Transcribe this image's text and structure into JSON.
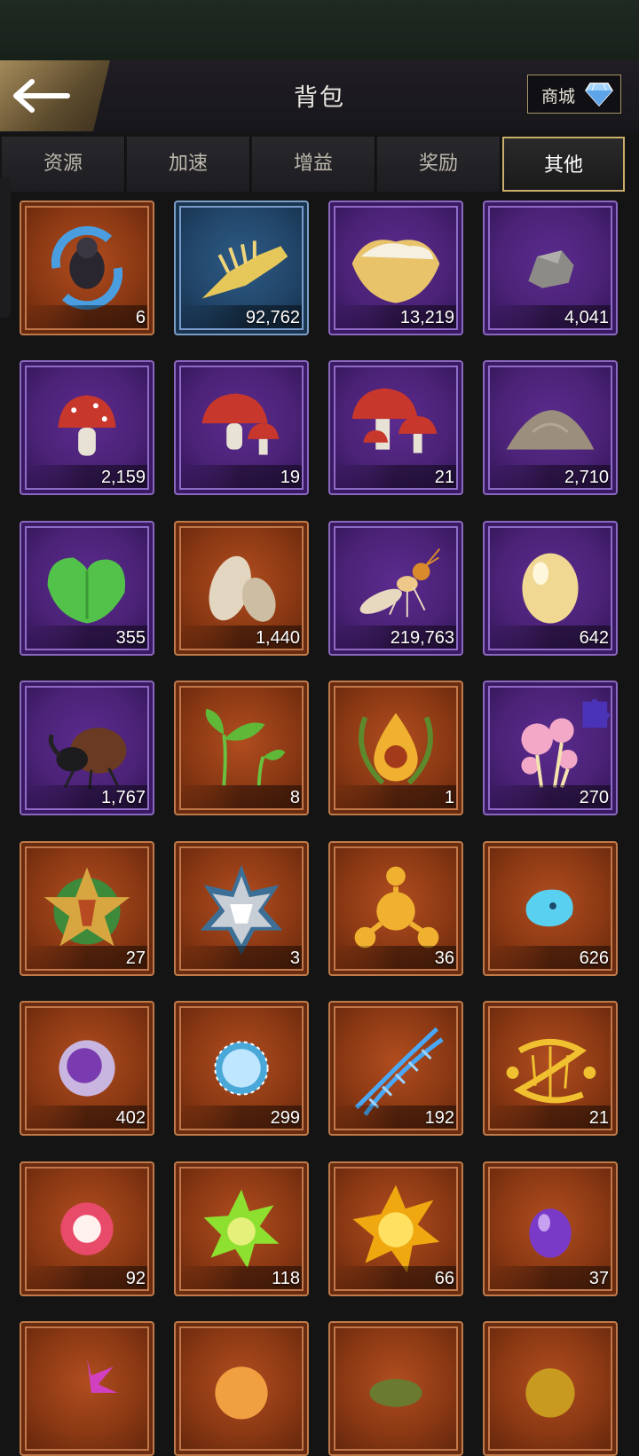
{
  "header": {
    "title": "背包",
    "back_icon": "back-arrow-icon",
    "shop_label": "商城",
    "shop_icon": "diamond-icon"
  },
  "tabs": [
    {
      "label": "资源",
      "active": false
    },
    {
      "label": "加速",
      "active": false
    },
    {
      "label": "增益",
      "active": false
    },
    {
      "label": "奖励",
      "active": false
    },
    {
      "label": "其他",
      "active": true
    }
  ],
  "items": [
    {
      "icon": "ant-swap-icon",
      "rarity": "orange",
      "count": "6"
    },
    {
      "icon": "fish-skeleton-icon",
      "rarity": "blue",
      "count": "92,762"
    },
    {
      "icon": "oyster-mushroom-icon",
      "rarity": "purple",
      "count": "13,219"
    },
    {
      "icon": "stone-icon",
      "rarity": "purple",
      "count": "4,041"
    },
    {
      "icon": "mushroom-icon",
      "rarity": "purple",
      "count": "2,159"
    },
    {
      "icon": "mushroom-pair-icon",
      "rarity": "purple",
      "count": "19"
    },
    {
      "icon": "mushroom-cluster-icon",
      "rarity": "purple",
      "count": "21"
    },
    {
      "icon": "sand-pile-icon",
      "rarity": "purple",
      "count": "2,710"
    },
    {
      "icon": "leaf-icon",
      "rarity": "purple",
      "count": "355"
    },
    {
      "icon": "seeds-icon",
      "rarity": "orange",
      "count": "1,440"
    },
    {
      "icon": "termite-icon",
      "rarity": "purple",
      "count": "219,763"
    },
    {
      "icon": "egg-icon",
      "rarity": "purple",
      "count": "642"
    },
    {
      "icon": "beetle-icon",
      "rarity": "purple",
      "count": "1,767"
    },
    {
      "icon": "sprout-icon",
      "rarity": "orange",
      "count": "8"
    },
    {
      "icon": "laurel-drop-icon",
      "rarity": "orange",
      "count": "1"
    },
    {
      "icon": "pink-mushroom-puzzle-icon",
      "rarity": "purple",
      "count": "270"
    },
    {
      "icon": "gold-star-medal-icon",
      "rarity": "orange",
      "count": "27"
    },
    {
      "icon": "silver-star-medal-icon",
      "rarity": "orange",
      "count": "3"
    },
    {
      "icon": "gold-molecule-icon",
      "rarity": "orange",
      "count": "36"
    },
    {
      "icon": "blue-crystal-icon",
      "rarity": "orange",
      "count": "626"
    },
    {
      "icon": "purple-cell-icon",
      "rarity": "orange",
      "count": "402"
    },
    {
      "icon": "blue-orb-icon",
      "rarity": "orange",
      "count": "299"
    },
    {
      "icon": "blue-dna-icon",
      "rarity": "orange",
      "count": "192"
    },
    {
      "icon": "gold-dna-icon",
      "rarity": "orange",
      "count": "21"
    },
    {
      "icon": "red-cell-icon",
      "rarity": "orange",
      "count": "92"
    },
    {
      "icon": "green-spiky-cell-icon",
      "rarity": "orange",
      "count": "118"
    },
    {
      "icon": "yellow-spiky-cell-icon",
      "rarity": "orange",
      "count": "66"
    },
    {
      "icon": "amethyst-drop-icon",
      "rarity": "orange",
      "count": "37"
    },
    {
      "icon": "pink-spiky-item-icon",
      "rarity": "orange",
      "count": ""
    },
    {
      "icon": "orange-flower-item-icon",
      "rarity": "orange",
      "count": ""
    },
    {
      "icon": "green-item-icon",
      "rarity": "orange",
      "count": ""
    },
    {
      "icon": "gold-item-icon",
      "rarity": "orange",
      "count": ""
    }
  ]
}
